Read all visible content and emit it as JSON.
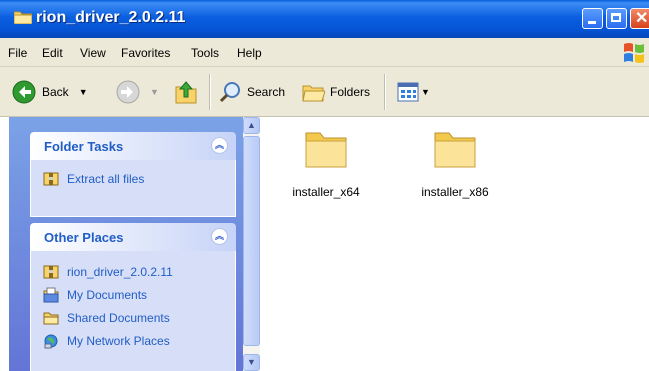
{
  "window": {
    "title": "rion_driver_2.0.2.11",
    "title_icon": "folder-icon",
    "buttons": [
      "minimize-icon",
      "maximize-icon",
      "close-icon"
    ]
  },
  "menu": {
    "items": [
      "File",
      "Edit",
      "View",
      "Favorites",
      "Tools",
      "Help"
    ]
  },
  "toolbar": {
    "back_label": "Back",
    "search_label": "Search",
    "folders_label": "Folders"
  },
  "folder_tasks": {
    "title": "Folder Tasks",
    "links": [
      {
        "label": "Extract all files",
        "icon": "extract-icon"
      }
    ]
  },
  "other_places": {
    "title": "Other Places",
    "links": [
      {
        "label": "rion_driver_2.0.2.11",
        "icon": "zip-folder-icon"
      },
      {
        "label": "My Documents",
        "icon": "my-documents-icon"
      },
      {
        "label": "Shared Documents",
        "icon": "shared-folder-icon"
      },
      {
        "label": "My Network Places",
        "icon": "network-icon"
      }
    ]
  },
  "files": [
    {
      "name": "installer_x64",
      "icon": "folder-icon"
    },
    {
      "name": "installer_x86",
      "icon": "folder-icon"
    }
  ],
  "colors": {
    "titlebar": "#0b5fe0",
    "pane_link": "#215dc6",
    "pane_bg": "#6375d6"
  }
}
